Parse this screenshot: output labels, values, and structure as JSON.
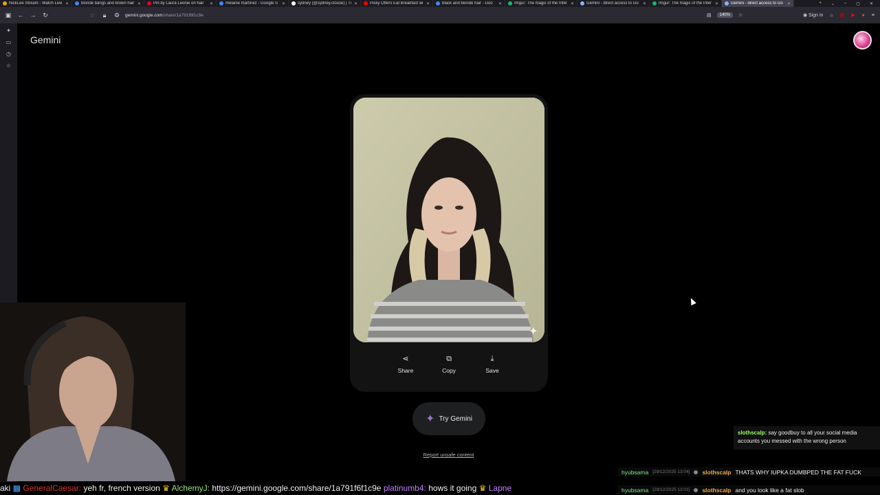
{
  "browser": {
    "tabs": [
      {
        "label": "NickLee Stream - Watch Live",
        "color": "#e5a50a"
      },
      {
        "label": "blonde bangs and brown hair",
        "color": "#4285f4"
      },
      {
        "label": "Pin by Laura Leonie on hair",
        "color": "#e60023"
      },
      {
        "label": "melanie martinez - Google S",
        "color": "#4285f4"
      },
      {
        "label": "sydney (@sydney.clouse) | Ti",
        "color": "#ffffff"
      },
      {
        "label": "Picky Otters Eat Breakfast wi",
        "color": "#ff0000"
      },
      {
        "label": "black and blonde hair - Goo",
        "color": "#4285f4"
      },
      {
        "label": "Imgur: The magic of the Inter",
        "color": "#1bb76e"
      },
      {
        "label": "Gemini - direct access to Go",
        "color": "#8ab4f8"
      },
      {
        "label": "Imgur: The magic of the Inter",
        "color": "#1bb76e"
      },
      {
        "label": "Gemini - direct access to Go",
        "color": "#8ab4f8",
        "active": true
      }
    ],
    "url_prefix": "gemini.google.com",
    "url_path": "/share/1a791f6f1c9e",
    "zoom": "140%",
    "sign_in": "Sign in"
  },
  "gemini": {
    "brand": "Gemini",
    "actions": {
      "share": "Share",
      "copy": "Copy",
      "save": "Save"
    },
    "try_label": "Try Gemini",
    "report": "Report unsafe content"
  },
  "chat": {
    "popup_user": "slothscalp:",
    "popup_msg": "say goodbuy to all your social media accounts you messed with the wrong person",
    "lines": [
      {
        "platform_user": "hyubsama",
        "time": "[29/12/2025 13:04]",
        "user": "slothscalp",
        "msg": "THATS WHY IUPKA DUMBPED THE FAT FUCK"
      },
      {
        "platform_user": "hyubsama",
        "time": "[29/12/2025 13:01]",
        "user": "slothscalp",
        "msg": "and you look like a fat slob"
      }
    ]
  },
  "ticker": {
    "prefix": "aki",
    "user1": "GeneralCaesar:",
    "msg1": "yeh fr, french version",
    "user2": "AlchemyJ:",
    "msg2": "https://gemini.google.com/share/1a791f6f1c9e",
    "user3": "platinumb4:",
    "msg3": "hows it going",
    "user4": "Lapne"
  }
}
